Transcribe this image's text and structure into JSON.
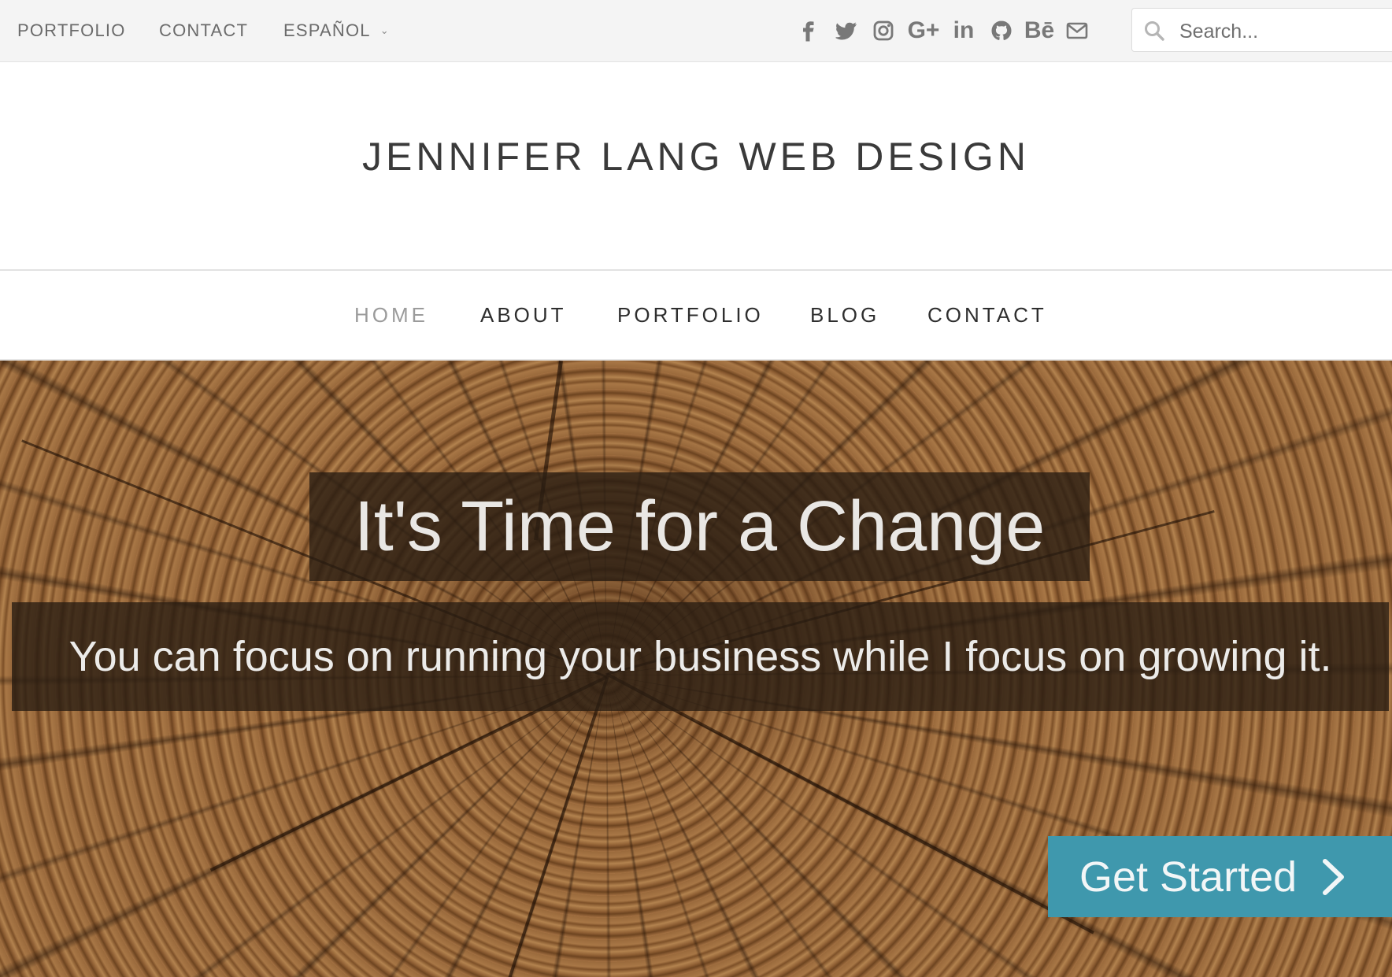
{
  "topbar": {
    "links": [
      {
        "label": "PORTFOLIO"
      },
      {
        "label": "CONTACT"
      },
      {
        "label": "ESPAÑOL"
      }
    ],
    "social_icons": [
      "facebook-icon",
      "twitter-icon",
      "instagram-icon",
      "google-plus-icon",
      "linkedin-icon",
      "github-icon",
      "behance-icon",
      "mail-icon"
    ],
    "search": {
      "placeholder": "Search..."
    }
  },
  "header": {
    "site_title": "JENNIFER LANG WEB DESIGN"
  },
  "nav": {
    "items": [
      {
        "label": "HOME",
        "active": true
      },
      {
        "label": "ABOUT"
      },
      {
        "label": "PORTFOLIO"
      },
      {
        "label": "BLOG"
      },
      {
        "label": "CONTACT"
      }
    ]
  },
  "hero": {
    "title": "It's Time for a Change",
    "subtitle": "You can focus on running your business while I focus on growing it.",
    "cta_label": "Get Started"
  },
  "colors": {
    "accent": "#3f98ad",
    "topbar_bg": "#f4f4f4",
    "nav_active": "#9b9b9b"
  }
}
